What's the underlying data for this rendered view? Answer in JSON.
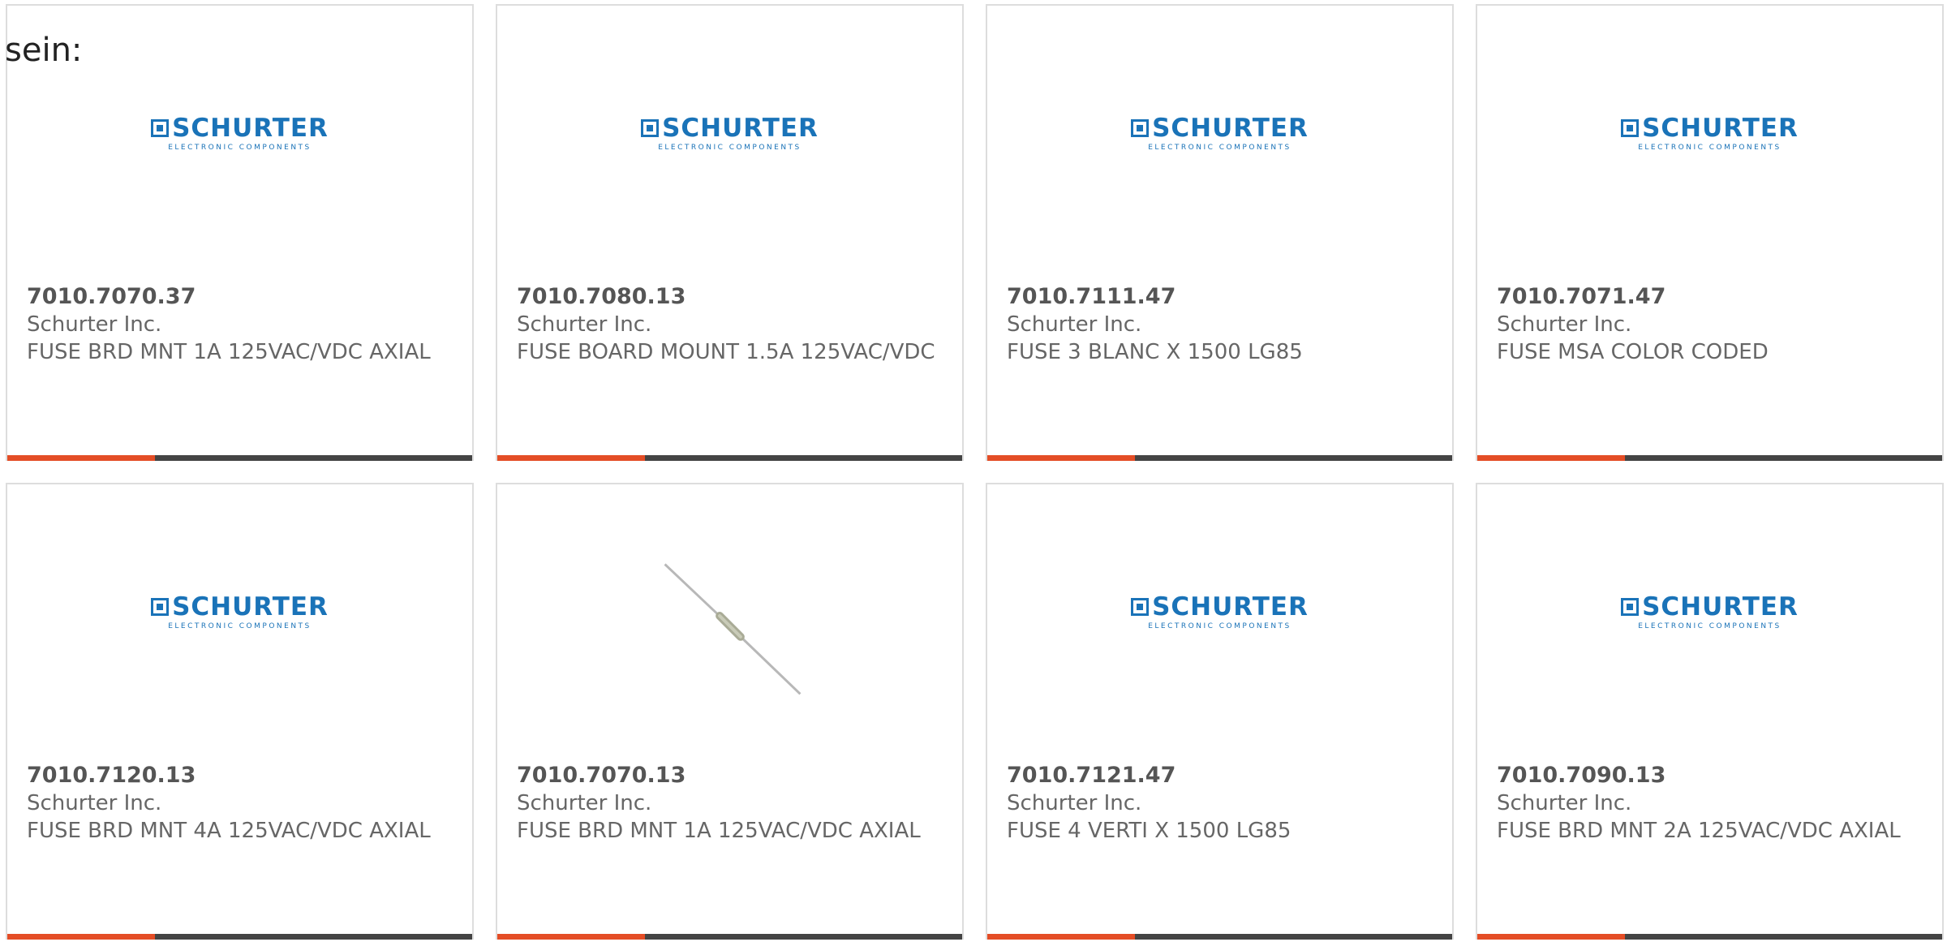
{
  "intro_text": "sein:",
  "logo": {
    "name": "SCHURTER",
    "subtitle": "ELECTRONIC COMPONENTS"
  },
  "colors": {
    "logo_blue": "#1a73b8",
    "accent_orange": "#e44d26",
    "bar_dark": "#444444",
    "text_gray": "#666666",
    "border": "#dddddd"
  },
  "products": [
    {
      "part": "7010.7070.37",
      "maker": "Schurter Inc.",
      "desc": "FUSE BRD MNT 1A 125VAC/VDC AXIAL",
      "image": "schurter-logo"
    },
    {
      "part": "7010.7080.13",
      "maker": "Schurter Inc.",
      "desc": "FUSE BOARD MOUNT 1.5A 125VAC/VDC",
      "image": "schurter-logo"
    },
    {
      "part": "7010.7111.47",
      "maker": "Schurter Inc.",
      "desc": "FUSE 3 BLANC X 1500 LG85",
      "image": "schurter-logo"
    },
    {
      "part": "7010.7071.47",
      "maker": "Schurter Inc.",
      "desc": "FUSE MSA COLOR CODED",
      "image": "schurter-logo"
    },
    {
      "part": "7010.7120.13",
      "maker": "Schurter Inc.",
      "desc": "FUSE BRD MNT 4A 125VAC/VDC AXIAL",
      "image": "schurter-logo"
    },
    {
      "part": "7010.7070.13",
      "maker": "Schurter Inc.",
      "desc": "FUSE BRD MNT 1A 125VAC/VDC AXIAL",
      "image": "axial-fuse-photo"
    },
    {
      "part": "7010.7121.47",
      "maker": "Schurter Inc.",
      "desc": "FUSE 4 VERTI X 1500 LG85",
      "image": "schurter-logo"
    },
    {
      "part": "7010.7090.13",
      "maker": "Schurter Inc.",
      "desc": "FUSE BRD MNT 2A 125VAC/VDC AXIAL",
      "image": "schurter-logo"
    }
  ]
}
